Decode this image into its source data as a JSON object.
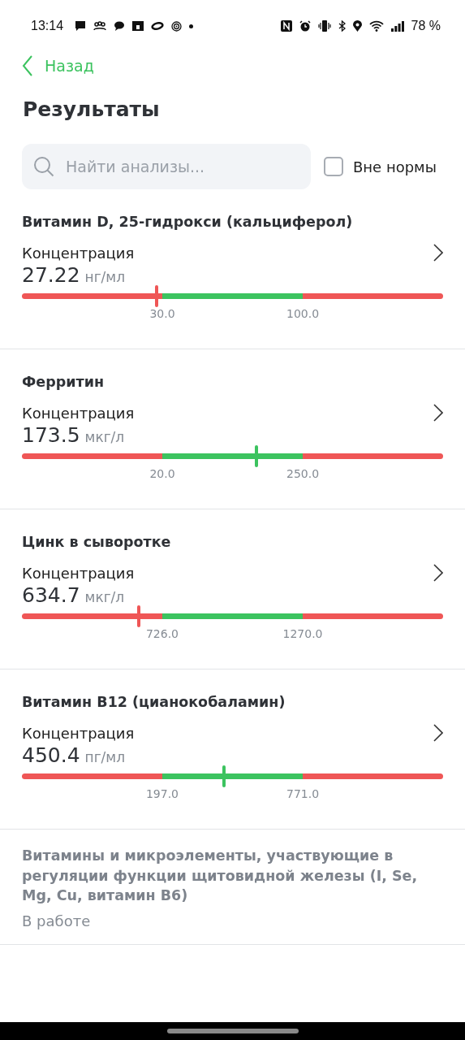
{
  "status_bar": {
    "time": "13:14",
    "battery": "78 %"
  },
  "nav": {
    "back": "Назад"
  },
  "title": "Результаты",
  "search": {
    "placeholder": "Найти анализы..."
  },
  "filter": {
    "label": "Вне нормы",
    "checked": false
  },
  "results": [
    {
      "name": "Витамин D, 25-гидрокси (кальциферол)",
      "parameter": "Концентрация",
      "value": "27.22",
      "unit": "нг/мл",
      "level": 0.32,
      "in_range": false,
      "low": "30.0",
      "high": "100.0"
    },
    {
      "name": "Ферритин",
      "parameter": "Концентрация",
      "value": "173.5",
      "unit": "мкг/л",
      "level": 0.557,
      "in_range": true,
      "low": "20.0",
      "high": "250.0"
    },
    {
      "name": "Цинк в сыворотке",
      "parameter": "Концентрация",
      "value": "634.7",
      "unit": "мкг/л",
      "level": 0.277,
      "in_range": false,
      "low": "726.0",
      "high": "1270.0"
    },
    {
      "name": "Витамин B12 (цианокобаламин)",
      "parameter": "Концентрация",
      "value": "450.4",
      "unit": "пг/мл",
      "level": 0.48,
      "in_range": true,
      "low": "197.0",
      "high": "771.0"
    }
  ],
  "pending": [
    {
      "name": "Витамины и микроэлементы, участвующие в регуляции функции щитовидной железы (I, Se, Mg, Cu, витамин B6)",
      "status": "В работе"
    }
  ]
}
